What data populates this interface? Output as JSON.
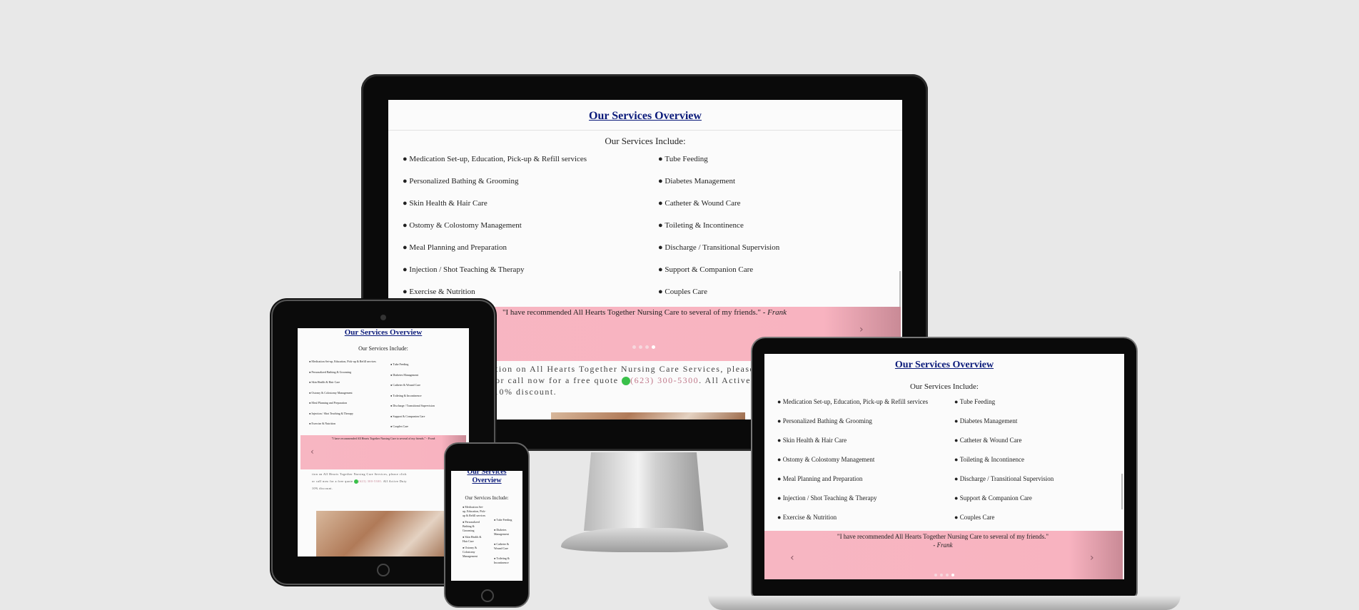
{
  "page": {
    "title": "Our Services Overview",
    "subtitle": "Our Services Include:",
    "services_left": [
      "Medication Set-up, Education, Pick-up & Refill services",
      "Personalized Bathing & Grooming",
      "Skin Health & Hair Care",
      "Ostomy & Colostomy Management",
      "Meal Planning and Preparation",
      "Injection / Shot Teaching & Therapy",
      "Exercise & Nutrition"
    ],
    "services_right": [
      "Tube Feeding",
      "Diabetes Management",
      "Catheter & Wound Care",
      "Toileting & Incontinence",
      "Discharge / Transitional Supervision",
      "Support & Companion Care",
      "Couples Care"
    ],
    "testimonial": {
      "quote": "\"I have recommended All Hearts Together Nursing Care to several of my friends.\" -",
      "author": "Frank"
    },
    "info": {
      "line1": "tion on All Hearts Together Nursing Care Services, please click",
      "line2_a": "or call now for a free quote",
      "phone": "(623) 300-5300",
      "line2_b": ". All Active Duty",
      "line3": "10% discount."
    },
    "carousel": {
      "prev_icon": "chevron-left-icon",
      "next_icon": "chevron-right-icon",
      "slides": 4,
      "active": 3
    }
  },
  "colors": {
    "background": "#e8e8e8",
    "title": "#0a1a7a",
    "band": "#f8b3c0",
    "phone": "#c0788a"
  }
}
